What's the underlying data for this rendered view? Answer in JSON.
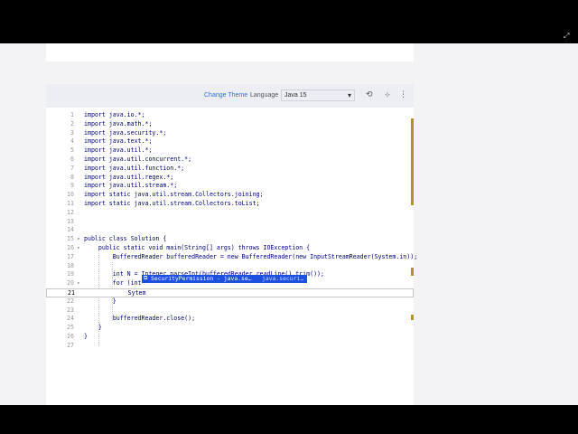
{
  "toolbar": {
    "change_theme": "Change Theme",
    "language_label": "Language",
    "language_value": "Java 15"
  },
  "editor": {
    "lines": [
      {
        "n": "1",
        "text": "import java.io.*;"
      },
      {
        "n": "2",
        "text": "import java.math.*;"
      },
      {
        "n": "3",
        "text": "import java.security.*;"
      },
      {
        "n": "4",
        "text": "import java.text.*;"
      },
      {
        "n": "5",
        "text": "import java.util.*;"
      },
      {
        "n": "6",
        "text": "import java.util.concurrent.*;"
      },
      {
        "n": "7",
        "text": "import java.util.function.*;"
      },
      {
        "n": "8",
        "text": "import java.util.regex.*;"
      },
      {
        "n": "9",
        "text": "import java.util.stream.*;"
      },
      {
        "n": "10",
        "text": "import static java.util.stream.Collectors.joining;"
      },
      {
        "n": "11",
        "text": "import static java.util.stream.Collectors.toList;"
      },
      {
        "n": "12",
        "text": ""
      },
      {
        "n": "13",
        "text": ""
      },
      {
        "n": "14",
        "text": ""
      },
      {
        "n": "15",
        "text": "public class Solution {"
      },
      {
        "n": "16",
        "text": "    public static void main(String[] args) throws IOException {"
      },
      {
        "n": "17",
        "text": "        BufferedReader bufferedReader = new BufferedReader(new InputStreamReader(System.in));"
      },
      {
        "n": "18",
        "text": ""
      },
      {
        "n": "19",
        "text": "        int N = Integer.parseInt(bufferedReader.readLine().trim());"
      },
      {
        "n": "20",
        "text": "        for (int"
      },
      {
        "n": "21",
        "text": "            Sytem"
      },
      {
        "n": "22",
        "text": "        }"
      },
      {
        "n": "23",
        "text": ""
      },
      {
        "n": "24",
        "text": "        bufferedReader.close();"
      },
      {
        "n": "25",
        "text": "    }"
      },
      {
        "n": "26",
        "text": "}"
      },
      {
        "n": "27",
        "text": ""
      }
    ],
    "autocomplete": {
      "label": "SecurityPermission - java.se…",
      "package": "java.securi…"
    }
  }
}
